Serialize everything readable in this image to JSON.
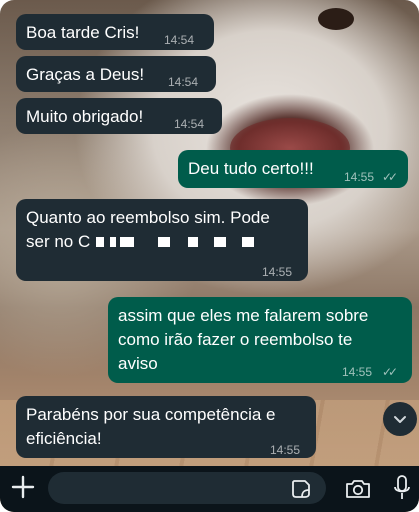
{
  "messages": [
    {
      "direction": "incoming",
      "text": "Boa tarde Cris!",
      "time": "14:54"
    },
    {
      "direction": "incoming",
      "text": "Graças a Deus!",
      "time": "14:54"
    },
    {
      "direction": "incoming",
      "text": "Muito obrigado!",
      "time": "14:54"
    },
    {
      "direction": "outgoing",
      "text": "Deu tudo certo!!!",
      "time": "14:55",
      "status": "read"
    },
    {
      "direction": "incoming",
      "line1": "Quanto ao reembolso sim. Pode",
      "line2_prefix": "ser no C",
      "time": "14:55"
    },
    {
      "direction": "outgoing",
      "line1": "assim que eles me falarem sobre",
      "line2": "como irão fazer o reembolso te",
      "line3": "aviso",
      "time": "14:55",
      "status": "read"
    },
    {
      "direction": "incoming",
      "line1": "Parabéns por sua competência e",
      "line2": "eficiência!",
      "time": "14:55"
    }
  ],
  "icons": {
    "read_ticks": "✓✓",
    "scroll_down": "chevron-down-icon",
    "attach": "plus-icon",
    "sticker": "sticker-icon",
    "camera": "camera-icon",
    "mic": "mic-icon"
  },
  "composer": {
    "placeholder": ""
  },
  "colors": {
    "incoming_bubble": "#1f2c34",
    "outgoing_bubble": "#005c4b",
    "input_bar": "#0b141a"
  }
}
